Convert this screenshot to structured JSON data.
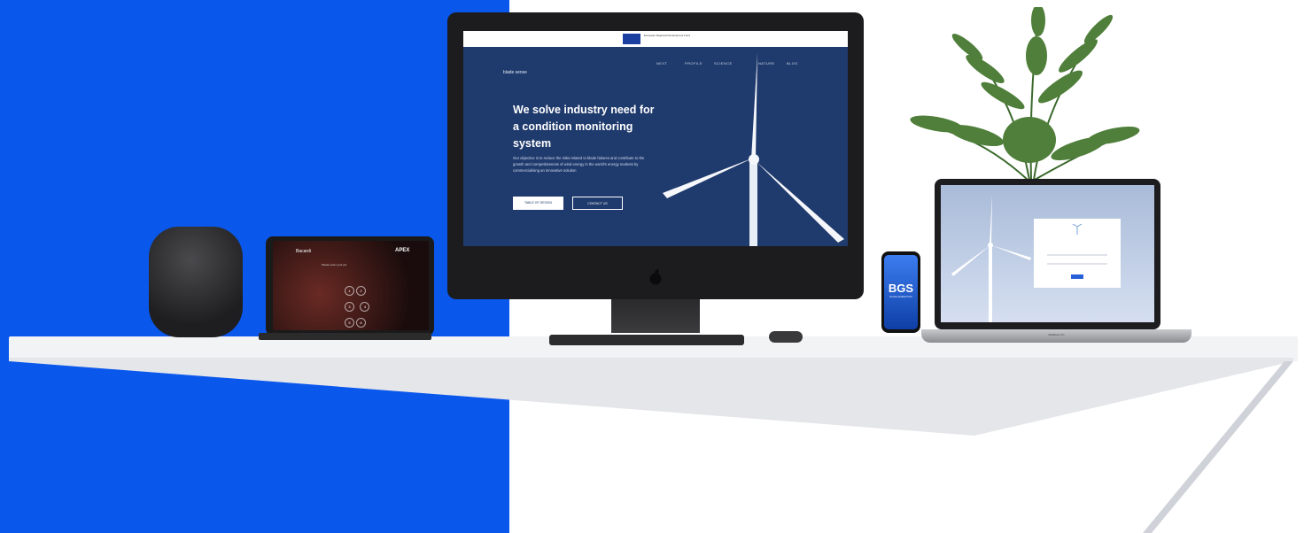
{
  "imac_site": {
    "eu_text": "European Regional Development Fund",
    "brand": "blade sense",
    "nav": [
      "NEXT",
      "PROFILE",
      "SCIENCE",
      "NATURE",
      "BLOG"
    ],
    "hero_title": "We solve industry need for a condition monitoring system",
    "hero_body": "Our objective is to reduce the risks related to blade failures and contribute to the growth and competitiveness of wind energy in the world's energy markets by commercialising an innovative solution",
    "btn_primary": "TABLE OF DESIGN",
    "btn_secondary": "CONTACT US"
  },
  "ipad": {
    "brand_left": "Bacardi",
    "brand_right": "APEX",
    "prompt": "Please enter your pin",
    "keys": [
      "1",
      "2",
      "3",
      "4",
      "5",
      "6",
      "7",
      "8",
      "9",
      "",
      "0",
      ""
    ]
  },
  "iphone": {
    "logo": "BGS",
    "tagline": "BLADE GENERATION"
  },
  "macbook": {
    "label": "MacBook Pro"
  },
  "colors": {
    "left_panel": "#0a57ec",
    "site_background": "#1f3a6c"
  }
}
